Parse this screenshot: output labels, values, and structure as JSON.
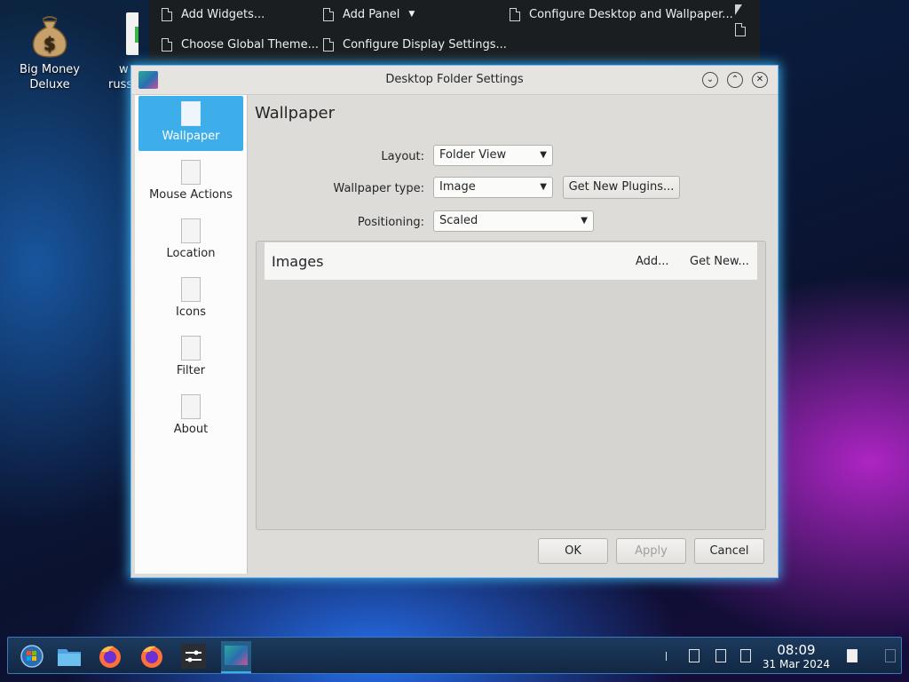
{
  "desktop": {
    "icons": [
      {
        "label_line1": "Big Money",
        "label_line2": "Deluxe"
      },
      {
        "label_line1": "w",
        "label_line2": "russ"
      }
    ]
  },
  "context_menu": {
    "items": [
      {
        "label": "Add Widgets...",
        "icon": "document-icon"
      },
      {
        "label": "Add Panel",
        "icon": "document-icon"
      },
      {
        "label": "Configure Desktop and Wallpaper...",
        "icon": "document-icon"
      },
      {
        "label": "Choose Global Theme...",
        "icon": "document-icon"
      },
      {
        "label": "Configure Display Settings...",
        "icon": "document-icon"
      }
    ]
  },
  "dialog": {
    "title": "Desktop Folder Settings",
    "sidebar": [
      {
        "label": "Wallpaper",
        "active": true
      },
      {
        "label": "Mouse Actions"
      },
      {
        "label": "Location"
      },
      {
        "label": "Icons"
      },
      {
        "label": "Filter"
      },
      {
        "label": "About"
      }
    ],
    "page_title": "Wallpaper",
    "form": {
      "layout_label": "Layout:",
      "layout_value": "Folder View",
      "wallpaper_type_label": "Wallpaper type:",
      "wallpaper_type_value": "Image",
      "get_new_plugins": "Get New Plugins...",
      "positioning_label": "Positioning:",
      "positioning_value": "Scaled"
    },
    "images_panel": {
      "title": "Images",
      "add": "Add...",
      "get_new": "Get New..."
    },
    "buttons": {
      "ok": "OK",
      "apply": "Apply",
      "cancel": "Cancel"
    }
  },
  "taskbar": {
    "time": "08:09",
    "date": "31 Mar 2024"
  },
  "colors": {
    "accent": "#3daee9",
    "menu_bg": "#1b1e20",
    "dialog_bg": "#dedcd8"
  }
}
